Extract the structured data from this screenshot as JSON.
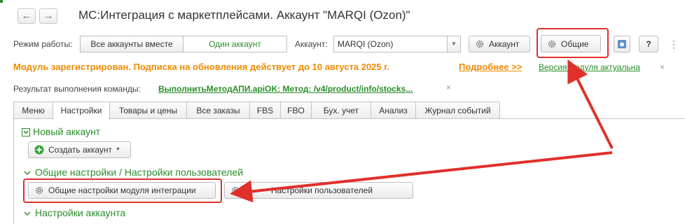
{
  "window": {
    "back_symbol": "←",
    "forward_symbol": "→",
    "title": "МС:Интеграция с маркетплейсами. Аккаунт \"MARQI (Ozon)\""
  },
  "mode": {
    "label": "Режим работы:",
    "options": [
      "Все аккаунты вместе",
      "Один аккаунт"
    ],
    "selected": "Один аккаунт"
  },
  "account": {
    "label": "Аккаунт:",
    "value": "MARQI (Ozon)",
    "button_label": "Аккаунт",
    "general_button_label": "Общие",
    "help_label": "?",
    "more_label": "⋮"
  },
  "notice": {
    "text": "Модуль зарегистрирован. Подписка на обновления действует до 10 августа 2025 г.",
    "more_link": "Подробнее >>",
    "version_link": "Версия модуля актуальна",
    "close": "×"
  },
  "result": {
    "label": "Результат выполнения команды:",
    "value": "ВыполнитьМетодАПИ.apiOK: Метод: /v4/product/info/stocks...",
    "close": "×"
  },
  "tabs": [
    {
      "label": "Меню"
    },
    {
      "label": "Настройки"
    },
    {
      "label": "Товары и цены"
    },
    {
      "label": "Все заказы"
    },
    {
      "label": "FBS"
    },
    {
      "label": "FBO"
    },
    {
      "label": "Бух. учет"
    },
    {
      "label": "Анализ"
    },
    {
      "label": "Журнал событий"
    }
  ],
  "active_tab": "Настройки",
  "settings": {
    "new_account_group": "Новый аккаунт",
    "create_account_button": "Создать аккаунт",
    "general_group": "Общие настройки / Настройки пользователей",
    "general_settings_button": "Общие настройки модуля интеграции",
    "user_settings_button": "Настройки пользователей",
    "account_settings_group": "Настройки аккаунта"
  },
  "colors": {
    "accent_green": "#2a8d2a",
    "notice_orange": "#f08a00",
    "highlight_red": "#e0302a"
  }
}
